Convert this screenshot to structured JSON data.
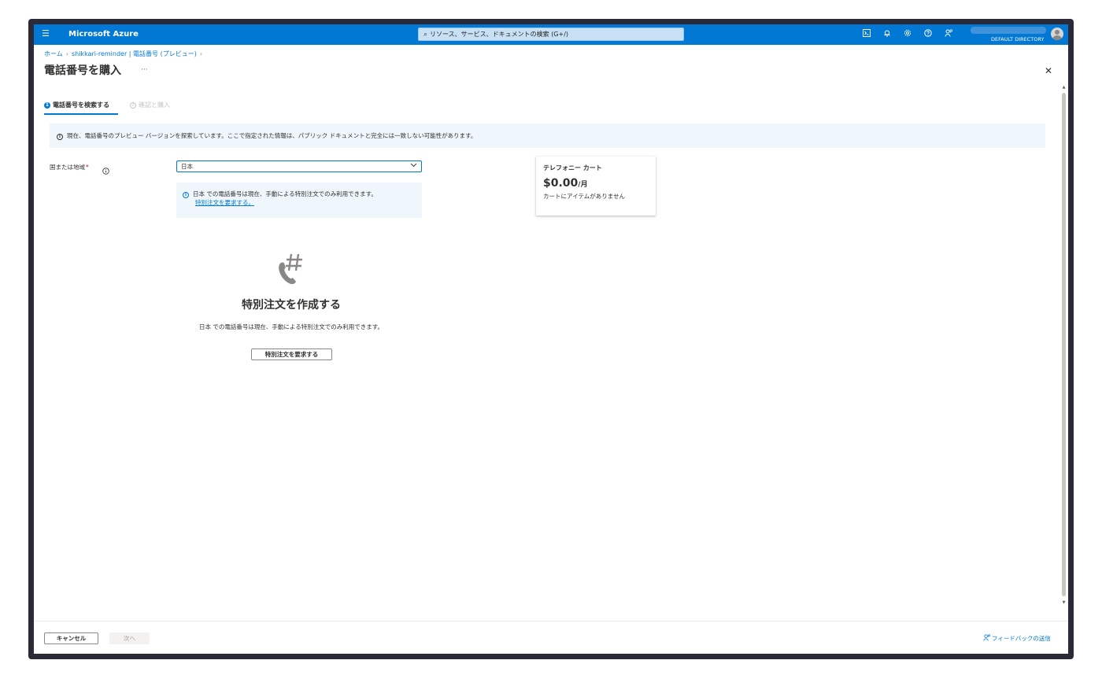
{
  "app": {
    "brand": "Microsoft Azure",
    "search_placeholder": "リソース、サービス、ドキュメントの検索 (G+/)",
    "directory": "DEFAULT DIRECTORY",
    "icons": [
      "hamburger-icon",
      "cloud-shell-icon",
      "bell-icon",
      "gear-icon",
      "help-icon",
      "feedback-person-icon",
      "avatar"
    ],
    "accent_color": "#0078d4"
  },
  "breadcrumb": {
    "items": [
      "ホーム",
      "shikkari-reminder | 電話番号 (プレビュー)"
    ]
  },
  "page": {
    "title": "電話番号を購入",
    "more": "···"
  },
  "steps": [
    {
      "number": "1",
      "label": "電話番号を検索する",
      "active": true
    },
    {
      "number": "2",
      "label": "確認と購入",
      "active": false
    }
  ],
  "banner": {
    "text": "現在、電話番号のプレビュー バージョンを探索しています。ここで指定された情報は、パブリック ドキュメントと完全には一致しない可能性があります。"
  },
  "form": {
    "country_label": "国または地域",
    "required_mark": "*",
    "country_value": "日本",
    "note_text": "日本 での電話番号は現在、手動による特別注文でのみ利用できます。",
    "note_link": "特別注文を要求する。"
  },
  "cart": {
    "title": "テレフォニー カート",
    "price": "$0.00",
    "unit": "/月",
    "empty_text": "カートにアイテムがありません"
  },
  "empty_state": {
    "title": "特別注文を作成する",
    "description": "日本 での電話番号は現在、手動による特別注文でのみ利用できます。",
    "button": "特別注文を要求する"
  },
  "footer": {
    "cancel": "キャンセル",
    "next": "次へ",
    "feedback": "フィードバックの送信"
  }
}
